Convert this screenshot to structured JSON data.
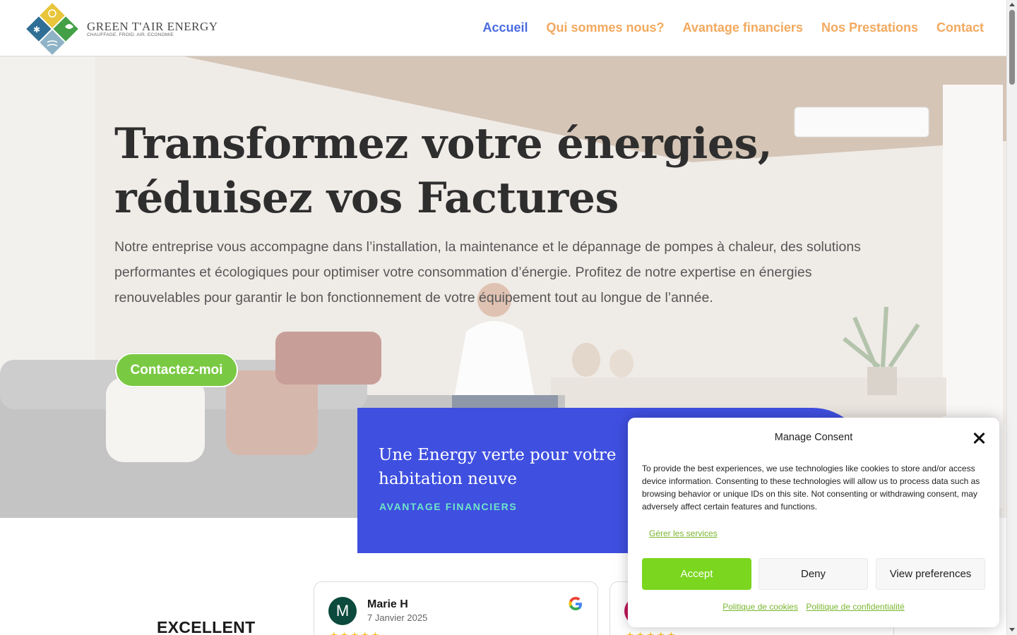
{
  "header": {
    "logo": {
      "name": "GREEN T'AIR ENERGY",
      "tagline": "CHAUFFAGE. FROID. AIR. ECONOMIE"
    },
    "nav": [
      {
        "label": "Accueil",
        "active": true
      },
      {
        "label": "Qui sommes nous?",
        "active": false
      },
      {
        "label": "Avantage financiers",
        "active": false
      },
      {
        "label": "Nos Prestations",
        "active": false
      },
      {
        "label": "Contact",
        "active": false
      }
    ]
  },
  "hero": {
    "title": "Transformez votre énergies, réduisez vos Factures",
    "text": "Notre entreprise vous accompagne dans l’installation, la maintenance et le dépannage de pompes à chaleur, des solutions performantes et écologiques pour optimiser votre consommation d’énergie. Profitez de notre expertise en énergies renouvelables pour garantir le bon fonctionnement de votre équipement tout au longue de l’année.",
    "button": "Contactez-moi"
  },
  "promo": {
    "title": "Une Energy verte pour votre habitation neuve",
    "subtitle": "AVANTAGE FINANCIERS"
  },
  "reviews": {
    "rating_label": "EXCELLENT",
    "items": [
      {
        "initial": "M",
        "name": "Marie H",
        "date": "7 Janvier 2025",
        "stars": "★★★★★"
      },
      {
        "initial": "",
        "name": "",
        "date": "",
        "stars": "★★★★★"
      }
    ]
  },
  "consent": {
    "title": "Manage Consent",
    "text": "To provide the best experiences, we use technologies like cookies to store and/or access device information. Consenting to these technologies will allow us to process data such as browsing behavior or unique IDs on this site. Not consenting or withdrawing consent, may adversely affect certain features and functions.",
    "manage_link": "Gérer les services",
    "accept": "Accept",
    "deny": "Deny",
    "preferences": "View preferences",
    "cookie_policy": "Politique de cookies",
    "privacy_policy": "Politique de confidentialité"
  },
  "colors": {
    "nav_link": "#f2a95e",
    "nav_active": "#4a6ae0",
    "cta_green": "#7ac943",
    "promo_blue": "#3f4fe0",
    "promo_accent": "#6fe6c8",
    "consent_accept": "#7ad61e"
  }
}
